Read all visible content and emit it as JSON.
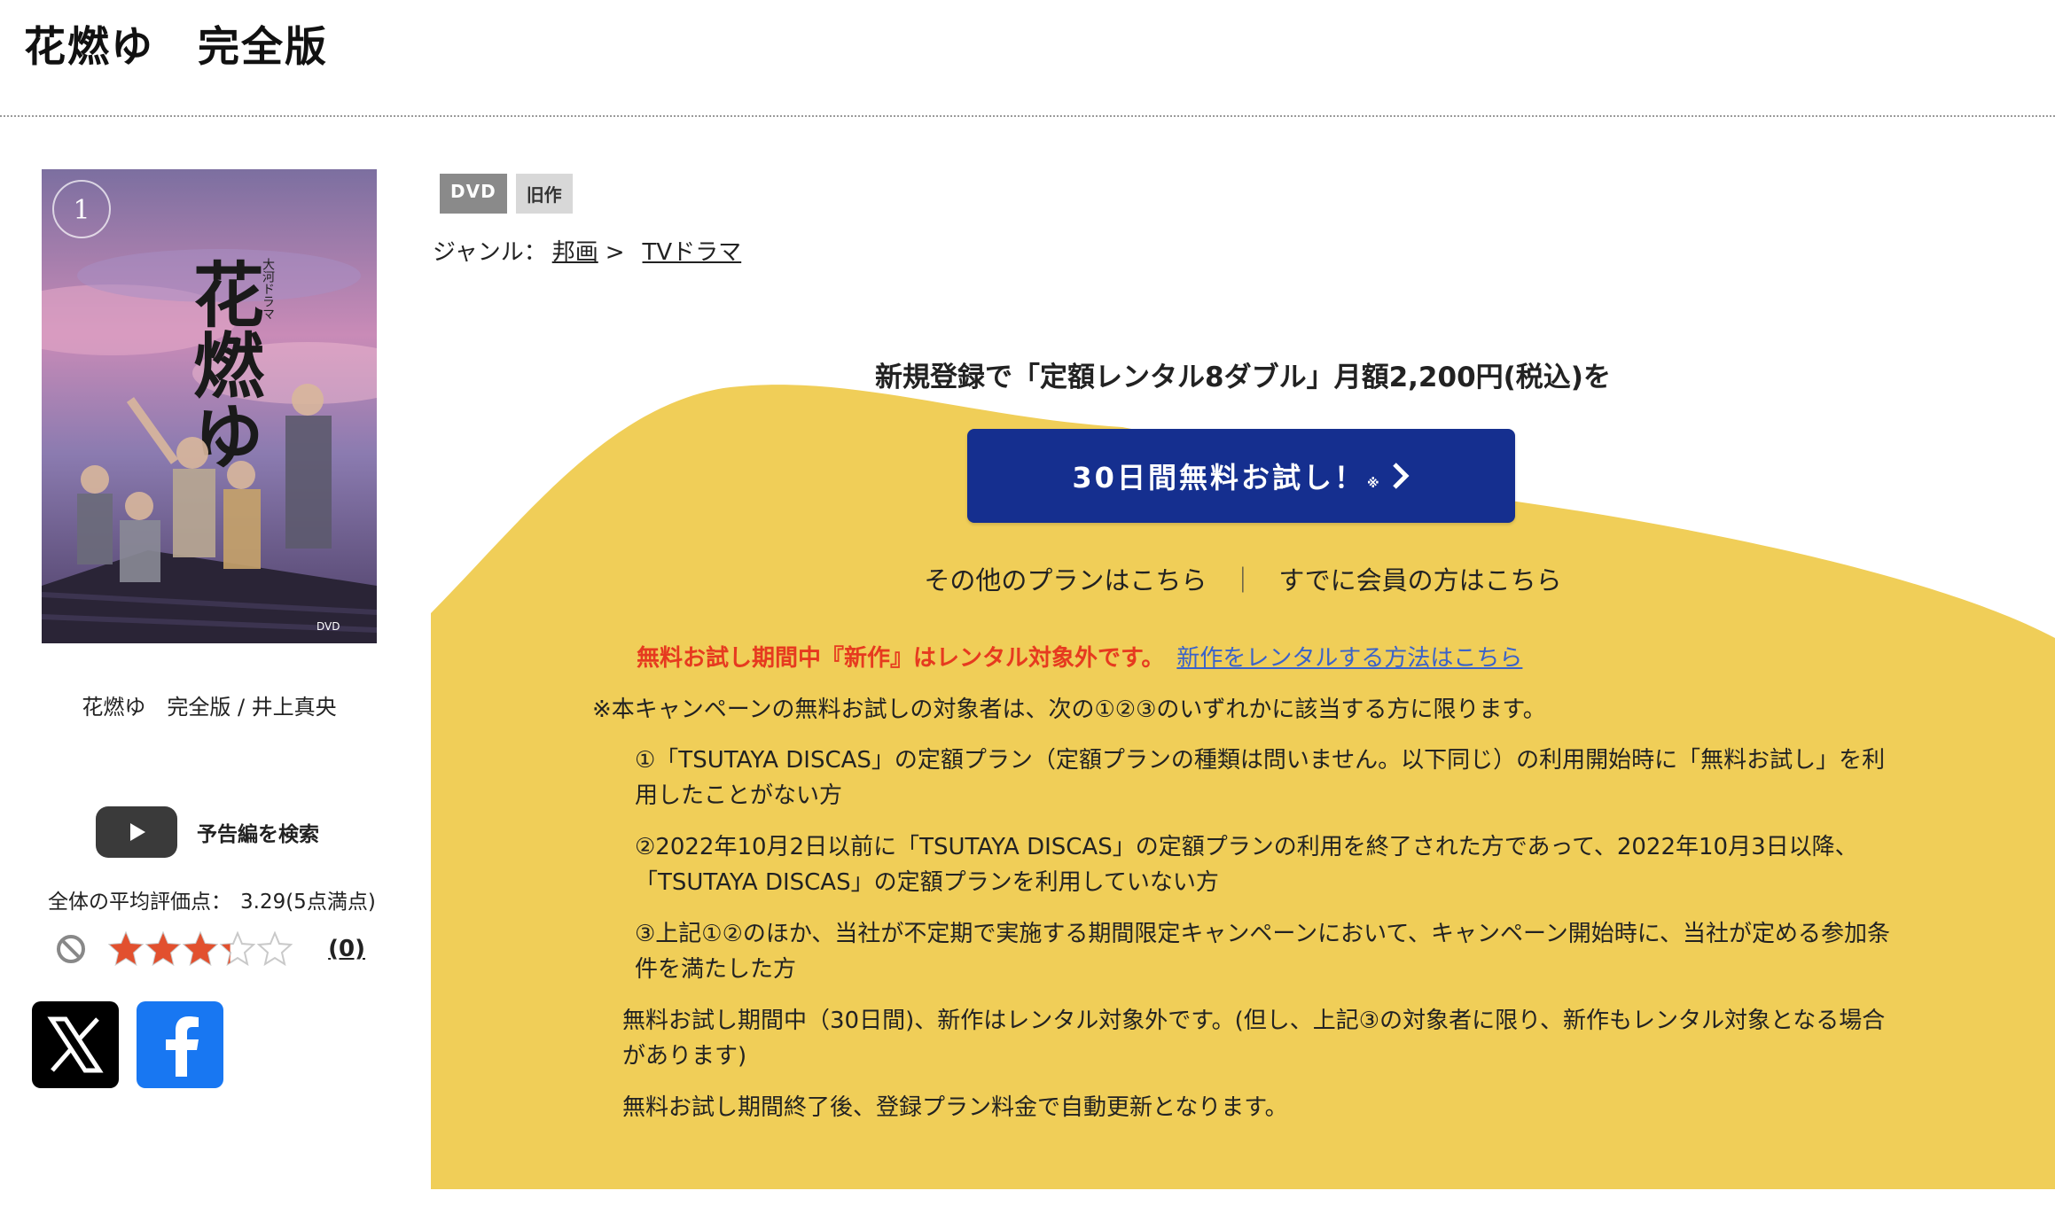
{
  "title": "花燃ゆ　完全版",
  "caption": "花燃ゆ　完全版 / 井上真央",
  "trailer_label": "予告編を検索",
  "average": {
    "label": "全体の平均評価点：",
    "value": "3.29(5点満点)"
  },
  "rating": {
    "score": 3.29,
    "max": 5,
    "count": "(0)"
  },
  "social": {
    "x_icon": "x-logo-icon",
    "facebook_icon": "facebook-logo-icon"
  },
  "badges": {
    "format": "DVD",
    "status": "旧作"
  },
  "genre": {
    "label": "ジャンル：",
    "level1": "邦画",
    "sep": ">",
    "level2": "TVドラマ"
  },
  "promo": {
    "headline": "新規登録で「定額レンタル8ダブル」月額2,200円(税込)を",
    "cta_label": "30日間無料お試し！",
    "cta_note": "※",
    "other_plans": "その他のプランはこちら",
    "separator": "｜",
    "members": "すでに会員の方はこちら"
  },
  "notice": {
    "warning": "無料お試し期間中『新作』はレンタル対象外です。",
    "warning_link": "新作をレンタルする方法はこちら",
    "intro": "※本キャンペーンの無料お試しの対象者は、次の①②③のいずれかに該当する方に限ります。",
    "conditions": [
      "①「TSUTAYA DISCAS」の定額プラン（定額プランの種類は問いません。以下同じ）の利用開始時に「無料お試し」を利用したことがない方",
      "②2022年10月2日以前に「TSUTAYA DISCAS」の定額プランの利用を終了された方であって、2022年10月3日以降、「TSUTAYA DISCAS」の定額プランを利用していない方",
      "③上記①②のほか、当社が不定期で実施する期間限定キャンペーンにおいて、キャンペーン開始時に、当社が定める参加条件を満たした方"
    ],
    "footer1": "無料お試し期間中（30日間)、新作はレンタル対象外です。(但し、上記③の対象者に限り、新作もレンタル対象となる場合があります)",
    "footer2": "無料お試し期間終了後、登録プラン料金で自動更新となります。"
  },
  "colors": {
    "accent_yellow": "#f0ce58",
    "cta_blue": "#152f8f",
    "warning_red": "#e63a1f",
    "link_blue": "#3a62c9",
    "star_orange": "#e2502e"
  },
  "cover": {
    "top_text": "大河ドラマ",
    "title_art": "花燃ゆ",
    "volume": "1"
  }
}
